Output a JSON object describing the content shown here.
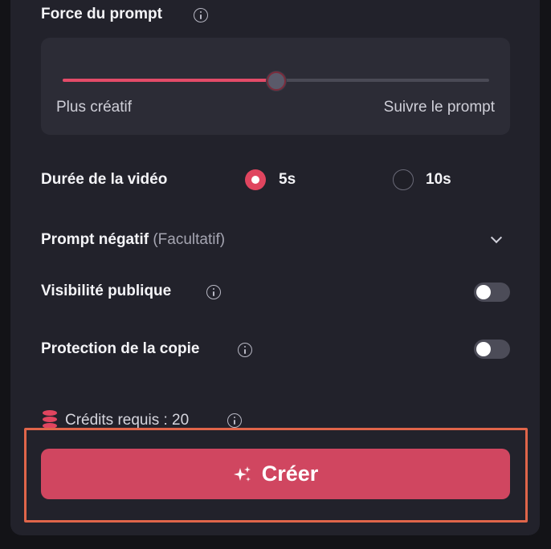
{
  "prompt_strength": {
    "label": "Force du prompt",
    "min_label": "Plus créatif",
    "max_label": "Suivre le prompt",
    "value_fraction": 0.5,
    "fill_color": "#e34b68"
  },
  "video_duration": {
    "label": "Durée de la vidéo",
    "options": [
      {
        "label": "5s",
        "selected": true
      },
      {
        "label": "10s",
        "selected": false
      }
    ]
  },
  "negative_prompt": {
    "label": "Prompt négatif",
    "optional_text": "(Facultatif)",
    "icon": "chevron-down-icon"
  },
  "public_visibility": {
    "label": "Visibilité publique",
    "enabled": false
  },
  "copy_protection": {
    "label": "Protection de la copie",
    "enabled": false
  },
  "credits": {
    "text": "Crédits requis : 20",
    "icon": "coins-icon"
  },
  "create_button": {
    "label": "Créer",
    "icon": "sparkle-icon",
    "color": "#d04660"
  },
  "colors": {
    "accent": "#e0455f",
    "panel": "#22222b",
    "highlight_frame": "#e0654a"
  }
}
